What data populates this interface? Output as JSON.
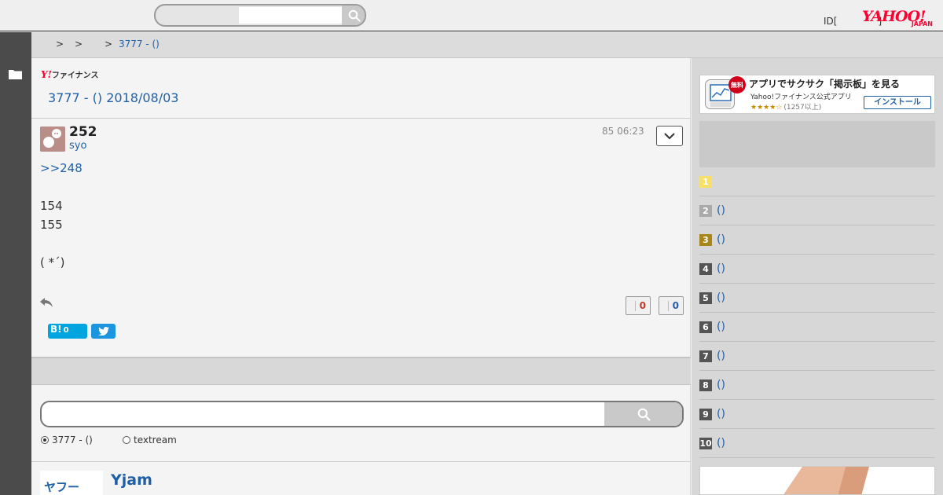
{
  "header": {
    "search_placeholder": "",
    "id_link": "ID[",
    "id_close": "]",
    "logo_big": "YAHOO!",
    "logo_small": "JAPAN"
  },
  "breadcrumb": {
    "sep1": ">",
    "sep2": ">",
    "sep3": ">",
    "current": "3777 - ()"
  },
  "main": {
    "logo_y": "Y!",
    "logo_text": "ファイナンス",
    "page_title": "3777 - () 2018/08/03"
  },
  "post": {
    "number": "252",
    "user": "syo",
    "meta": "85 06:23",
    "reply_to": ">>248",
    "line1": "154",
    "line2": "155",
    "line3": "( *´)",
    "good_count": "0",
    "bad_count": "0",
    "hatena_label": "B!",
    "hatena_count": "0"
  },
  "board_search": {
    "placeholder": "",
    "option1": "3777 - ()",
    "option2": "textream"
  },
  "yjam": {
    "thumb_text": "ヤフー",
    "title": "Yjam"
  },
  "sidebar": {
    "app_banner": {
      "badge": "無料",
      "headline": "アプリでサクサク「掲示板」を見る",
      "subtitle": "Yahoo!ファイナンス公式アプリ",
      "stars": "★★★★☆",
      "rating_count": "(1257以上)",
      "install_label": "インストール"
    },
    "ranking": [
      {
        "rank": "1",
        "text": "",
        "color": "#f7e06a"
      },
      {
        "rank": "2",
        "text": "()",
        "color": "#aaaaaa"
      },
      {
        "rank": "3",
        "text": "()",
        "color": "#a8861a"
      },
      {
        "rank": "4",
        "text": "()",
        "color": "#555555"
      },
      {
        "rank": "5",
        "text": "()",
        "color": "#555555"
      },
      {
        "rank": "6",
        "text": "()",
        "color": "#555555"
      },
      {
        "rank": "7",
        "text": "()",
        "color": "#555555"
      },
      {
        "rank": "8",
        "text": "()",
        "color": "#555555"
      },
      {
        "rank": "9",
        "text": "()",
        "color": "#555555"
      },
      {
        "rank": "10",
        "text": "()",
        "color": "#555555"
      }
    ]
  },
  "colors": {
    "accent_link": "#1f5fa8",
    "yahoo_red": "#ff0033",
    "left_rail": "#4b4b4b"
  }
}
